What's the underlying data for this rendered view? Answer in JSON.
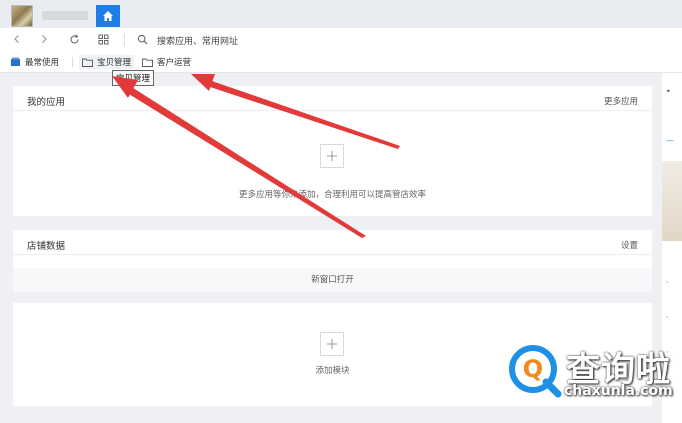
{
  "titlebar": {
    "home_icon": "home-icon"
  },
  "toolbar": {
    "search_label": "搜索应用、常用网址",
    "icons": [
      "back-icon",
      "forward-icon",
      "refresh-icon",
      "grid-icon",
      "search-icon"
    ]
  },
  "bookmarks": {
    "items": [
      {
        "label": "最常使用",
        "icon": "stack-icon"
      },
      {
        "label": "宝贝管理",
        "icon": "folder-icon"
      },
      {
        "label": "客户运营",
        "icon": "folder-icon"
      }
    ],
    "tooltip": "宝贝管理"
  },
  "cards": {
    "apps": {
      "title": "我的应用",
      "link": "更多应用",
      "hint": "更多应用等你来添加，合理利用可以提高管店效率"
    },
    "shop": {
      "title": "店铺数据",
      "link": "设置",
      "open": "新窗口打开"
    },
    "module": {
      "hint": "添加模块"
    }
  },
  "watermark": {
    "cn": "查询啦",
    "en": "chaxunla.com"
  },
  "colors": {
    "accent": "#1e7ee6",
    "arrow": "#e23a3a"
  }
}
